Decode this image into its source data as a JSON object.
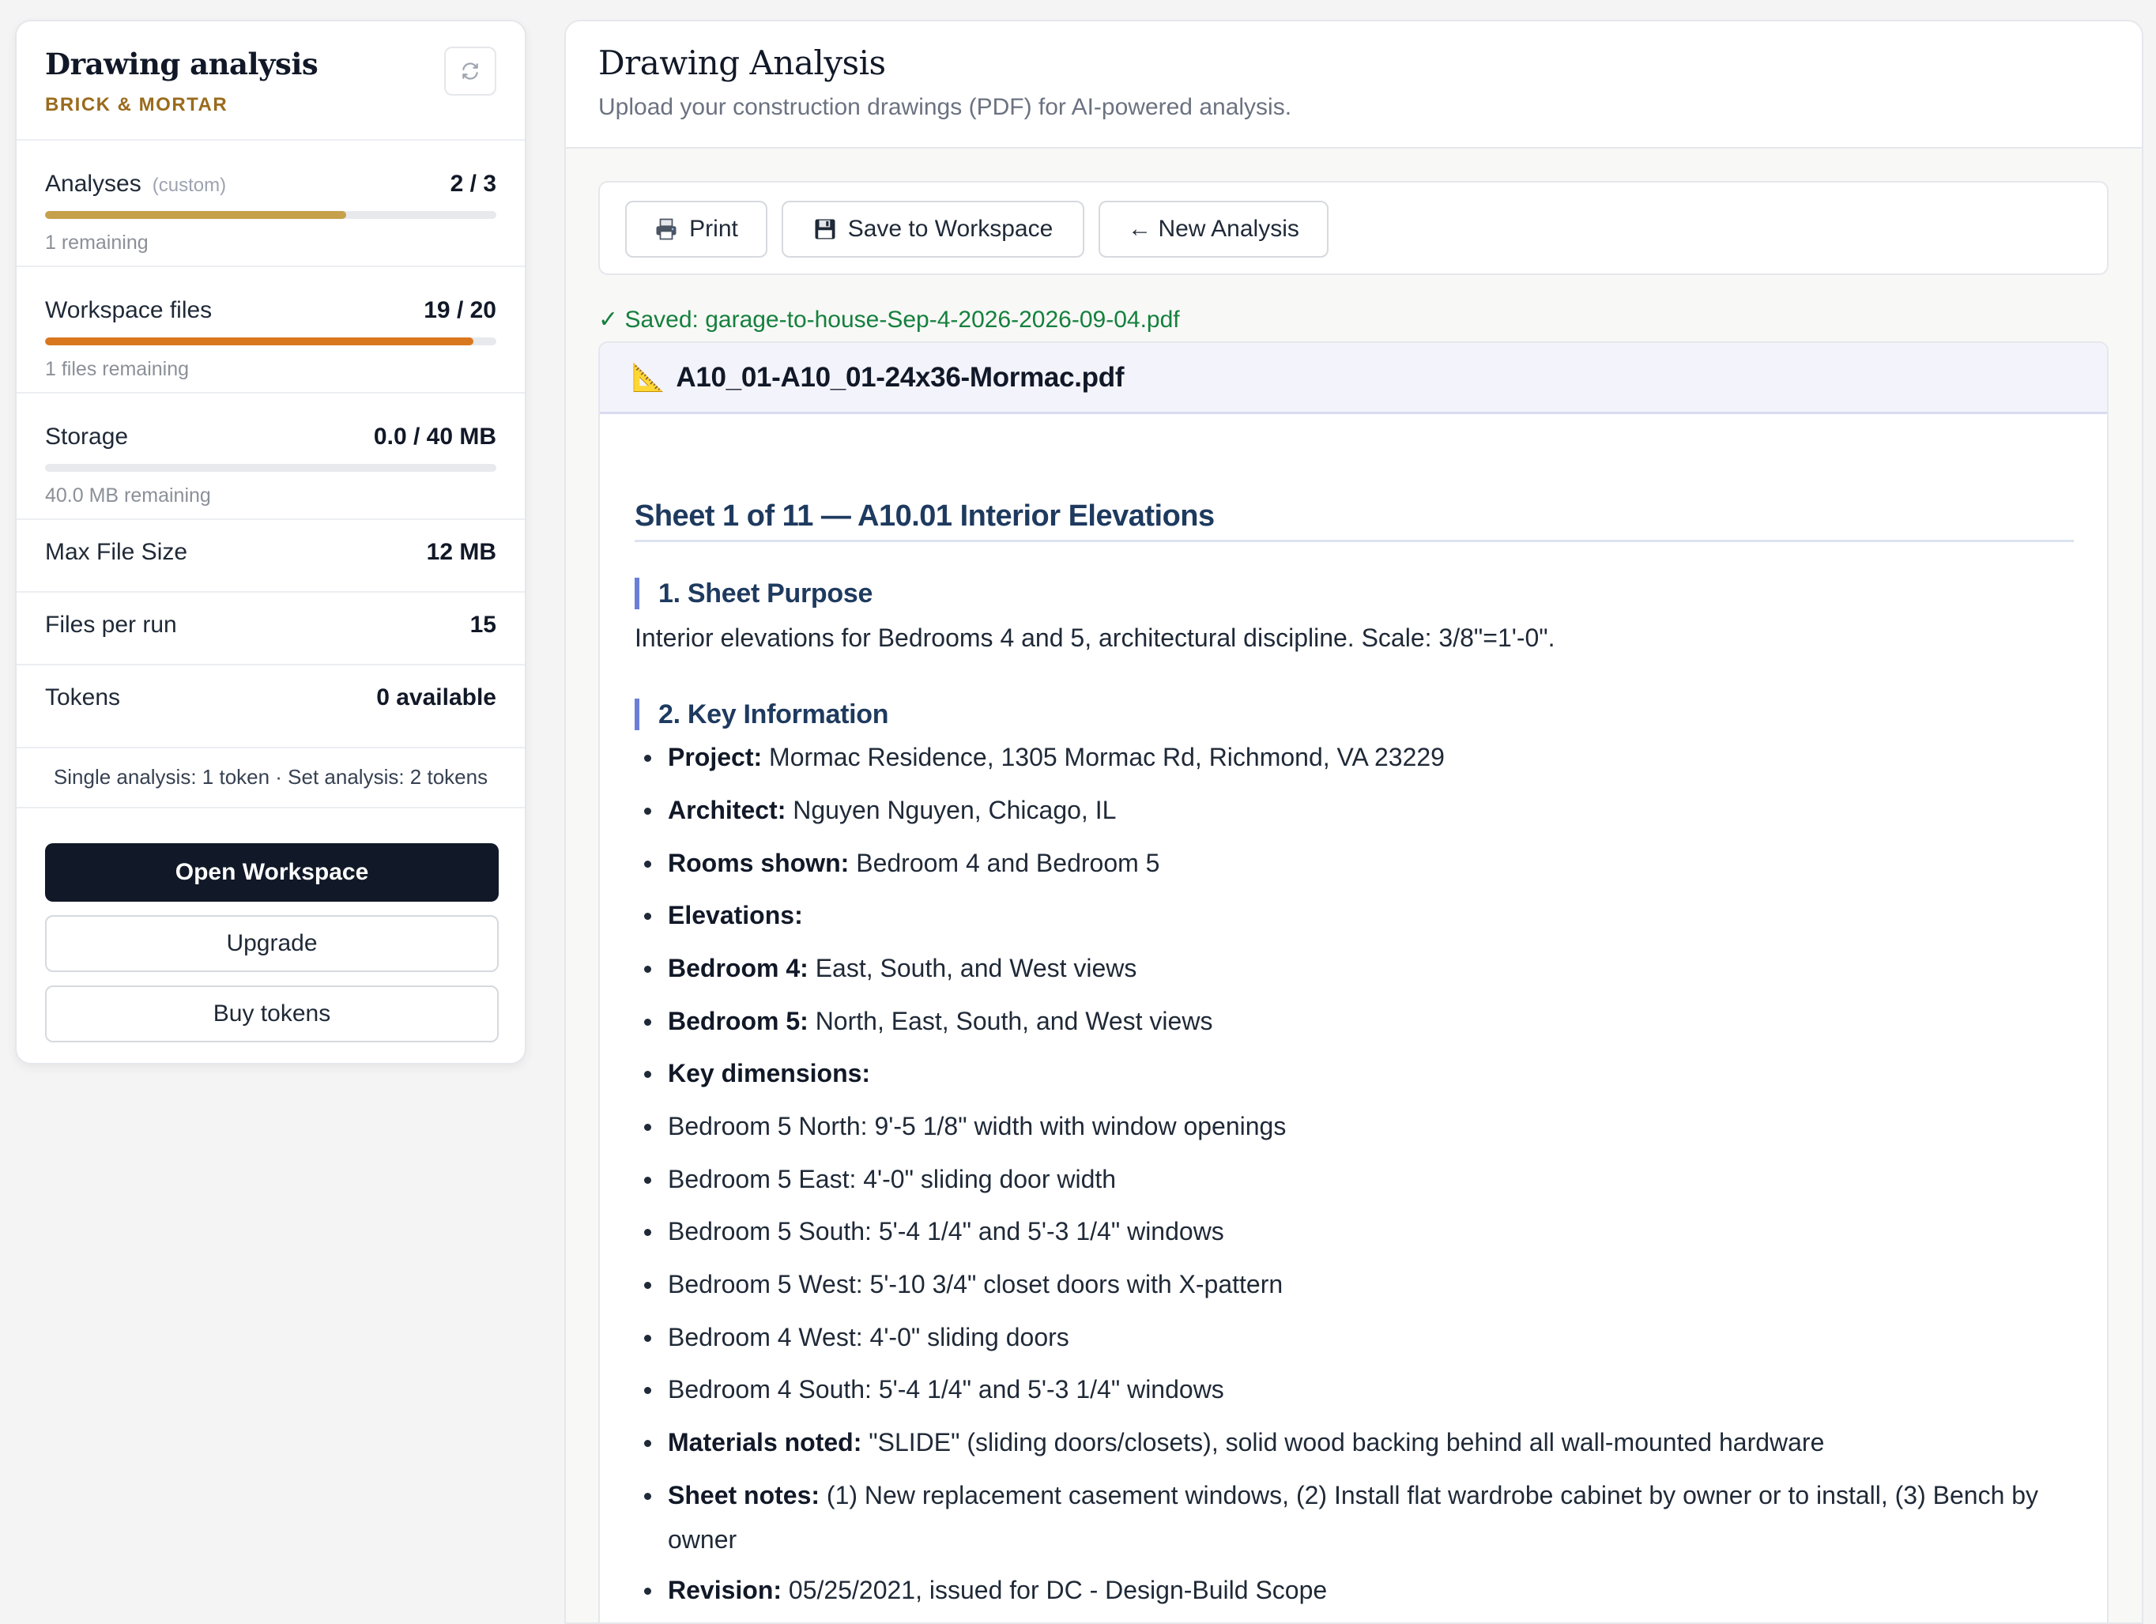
{
  "sidebar": {
    "title": "Drawing analysis",
    "subtitle": "BRICK & MORTAR",
    "refresh_icon": "refresh-icon",
    "meters": [
      {
        "label": "Analyses",
        "hint": "(custom)",
        "value": "2 / 3",
        "remaining": "1 remaining",
        "fraction": 0.667,
        "color": "#c6a04a"
      },
      {
        "label": "Workspace files",
        "hint": "",
        "value": "19 / 20",
        "remaining": "1 files remaining",
        "fraction": 0.95,
        "color": "#d9771f"
      },
      {
        "label": "Storage",
        "hint": "",
        "value": "0.0 / 40 MB",
        "remaining": "40.0 MB remaining",
        "fraction": 0.0,
        "color": "#c6a04a"
      }
    ],
    "stats": [
      {
        "label": "Max File Size",
        "value": "12 MB"
      },
      {
        "label": "Files per run",
        "value": "15"
      },
      {
        "label": "Tokens",
        "value": "0 available"
      }
    ],
    "cost_note": "Single analysis: 1 token · Set analysis: 2 tokens",
    "open_workspace": "Open Workspace",
    "upgrade": "Upgrade",
    "buy_tokens": "Buy tokens"
  },
  "main": {
    "title": "Drawing Analysis",
    "description": "Upload your construction drawings (PDF) for AI-powered analysis.",
    "toolbar": {
      "print": "Print",
      "save": "Save to Workspace",
      "new_analysis": "← New Analysis"
    },
    "saved_message": "✓ Saved: garage-to-house-Sep-4-2026-2026-09-04.pdf",
    "document": {
      "file_icon": "📐",
      "file_name": "A10_01-A10_01-24x36-Mormac.pdf",
      "sheet_title": "Sheet 1 of 11 — A10.01 Interior Elevations",
      "sections": [
        {
          "title": "1. Sheet Purpose",
          "text": "Interior elevations for Bedrooms 4 and 5, architectural discipline. Scale: 3/8\"=1'-0\"."
        },
        {
          "title": "2. Key Information"
        }
      ],
      "key_info": [
        {
          "label": "Project:",
          "text": " Mormac Residence, 1305 Mormac Rd, Richmond, VA 23229"
        },
        {
          "label": "Architect:",
          "text": " Nguyen Nguyen, Chicago, IL"
        },
        {
          "label": "Rooms shown:",
          "text": " Bedroom 4 and Bedroom 5"
        },
        {
          "label": "Elevations:",
          "text": ""
        },
        {
          "label": "Bedroom 4:",
          "text": " East, South, and West views"
        },
        {
          "label": "Bedroom 5:",
          "text": " North, East, South, and West views"
        },
        {
          "label": "Key dimensions:",
          "text": ""
        },
        {
          "label": "",
          "text": "Bedroom 5 North: 9'-5 1/8\" width with window openings"
        },
        {
          "label": "",
          "text": "Bedroom 5 East: 4'-0\" sliding door width"
        },
        {
          "label": "",
          "text": "Bedroom 5 South: 5'-4 1/4\" and 5'-3 1/4\" windows"
        },
        {
          "label": "",
          "text": "Bedroom 5 West: 5'-10 3/4\" closet doors with X-pattern"
        },
        {
          "label": "",
          "text": "Bedroom 4 West: 4'-0\" sliding doors"
        },
        {
          "label": "",
          "text": "Bedroom 4 South: 5'-4 1/4\" and 5'-3 1/4\" windows"
        },
        {
          "label": "Materials noted:",
          "text": " \"SLIDE\" (sliding doors/closets), solid wood backing behind all wall-mounted hardware"
        },
        {
          "label": "Sheet notes:",
          "text": " (1) New replacement casement windows, (2) Install flat wardrobe cabinet by owner or to install, (3) Bench by owner"
        },
        {
          "label": "Revision:",
          "text": " 05/25/2021, issued for DC - Design-Build Scope"
        }
      ]
    }
  }
}
